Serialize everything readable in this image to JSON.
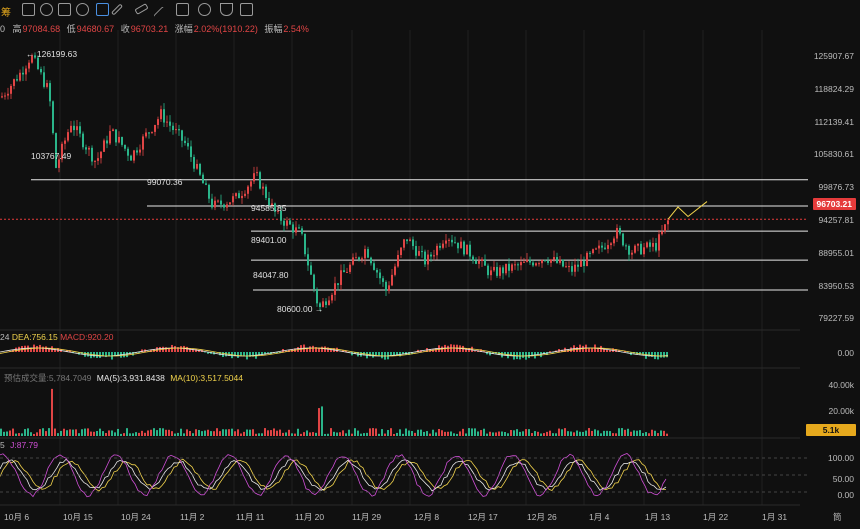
{
  "colors": {
    "up": "#e04545",
    "down": "#2ab58a",
    "hline": "#e8e8e8",
    "price_tag": "#e53b3b",
    "vol_tag": "#e6a91d",
    "k": "#f1d34c",
    "d": "#e8e8e8",
    "j": "#cf4fd6",
    "dea": "#f1d34c",
    "macd_line": "#e8e8e8"
  },
  "toolbar": {
    "title_fragment": "筹",
    "icons": [
      "measure-icon",
      "refresh-icon",
      "compare-icon",
      "settings-icon",
      "crop-icon",
      "pencil-icon",
      "ruler-icon",
      "line-icon",
      "text-icon",
      "image-icon",
      "compass-icon",
      "filter-icon",
      "delete-icon"
    ]
  },
  "info": {
    "open_prefix": "0",
    "high_label": "高",
    "high_value": "97084.68",
    "low_label": "低",
    "low_value": "94680.67",
    "close_label": "收",
    "close_value": "96703.21",
    "change_label": "涨幅",
    "change_value": "2.02%(1910.22)",
    "amp_label": "振幅",
    "amp_value": "2.54%"
  },
  "levels": [
    {
      "label": "99070.36",
      "price": 99070.36
    },
    {
      "label": "103767.49",
      "price": 103767.49
    },
    {
      "label": "94585.85",
      "price": 94585.85
    },
    {
      "label": "89401.00",
      "price": 89401.0
    },
    {
      "label": "84047.80",
      "price": 84047.8
    }
  ],
  "annotations": {
    "high": "← 126199.63",
    "low": "80600.00 →"
  },
  "price_axis": [
    "125907.67",
    "118824.29",
    "112139.41",
    "105830.61",
    "99876.73",
    "94257.81",
    "88955.01",
    "83950.53",
    "79227.59"
  ],
  "current_price": "96703.21",
  "macd": {
    "prefix": "24",
    "dea_label": "DEA:756.15",
    "macd_label": "MACD:920.20",
    "axis": [
      "0.00"
    ]
  },
  "volume": {
    "label1": "预估成交量:5,784.7049",
    "label2": "MA(5):3,931.8438",
    "label3": "MA(10):3,517.5044",
    "axis": [
      "40.00k",
      "20.00k"
    ],
    "tag": "5.1k"
  },
  "kdj": {
    "prefix": "5",
    "j_label": "J:87.79",
    "axis": [
      "100.00",
      "50.00",
      "0.00"
    ]
  },
  "dates": [
    "10月 6",
    "10月 15",
    "10月 24",
    "11月 2",
    "11月 11",
    "11月 20",
    "11月 29",
    "12月 8",
    "12月 17",
    "12月 26",
    "1月 4",
    "1月 13",
    "1月 22",
    "1月 31"
  ],
  "legend_right": "筒"
}
